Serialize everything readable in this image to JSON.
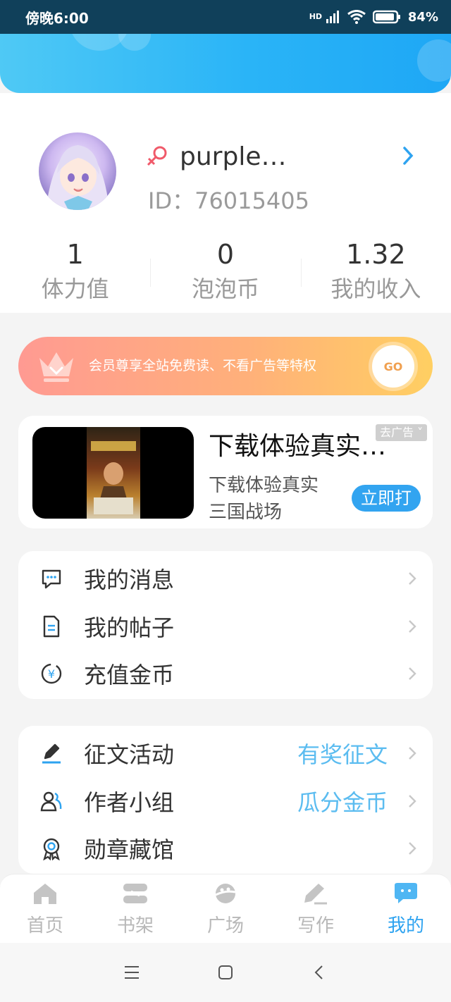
{
  "status_bar": {
    "time": "傍晚6:00",
    "network": "HD",
    "battery": "84%"
  },
  "profile": {
    "username": "purple…",
    "id_text": "ID：76015405"
  },
  "stats": [
    {
      "value": "1",
      "label": "体力值"
    },
    {
      "value": "0",
      "label": "泡泡币"
    },
    {
      "value": "1.32",
      "label": "我的收入"
    }
  ],
  "vip": {
    "text": "会员尊享全站免费读、不看广告等特权",
    "button": "GO"
  },
  "ad": {
    "title": "下载体验真实…",
    "tag": "去广告 ˅",
    "description": "下载体验真实三国战场",
    "cta": "立即打"
  },
  "menu_group_1": [
    {
      "label": "我的消息",
      "icon": "message-icon"
    },
    {
      "label": "我的帖子",
      "icon": "post-icon"
    },
    {
      "label": "充值金币",
      "icon": "coin-icon"
    }
  ],
  "menu_group_2": [
    {
      "label": "征文活动",
      "extra": "有奖征文",
      "icon": "pen-icon"
    },
    {
      "label": "作者小组",
      "extra": "瓜分金币",
      "icon": "group-icon"
    },
    {
      "label": "勋章藏馆",
      "extra": "",
      "icon": "medal-icon"
    }
  ],
  "tabbar": [
    {
      "label": "首页",
      "icon": "home-icon"
    },
    {
      "label": "书架",
      "icon": "bookshelf-icon"
    },
    {
      "label": "广场",
      "icon": "square-icon"
    },
    {
      "label": "写作",
      "icon": "write-icon"
    },
    {
      "label": "我的",
      "icon": "me-icon",
      "active": true
    }
  ],
  "colors": {
    "accent": "#2ea3f0",
    "vip_start": "#ff9a92",
    "vip_end": "#ffcf62",
    "link": "#5bbcf0"
  }
}
